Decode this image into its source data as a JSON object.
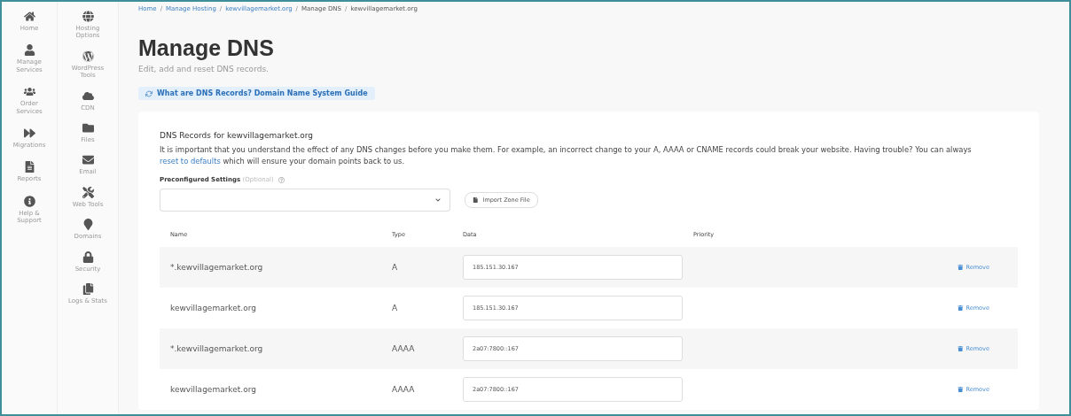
{
  "primary_nav": [
    {
      "label": "Home"
    },
    {
      "label": "Manage Services"
    },
    {
      "label": "Order Services"
    },
    {
      "label": "Migrations"
    },
    {
      "label": "Reports"
    },
    {
      "label": "Help & Support"
    }
  ],
  "secondary_nav": [
    {
      "label": "Hosting Options"
    },
    {
      "label": "WordPress Tools"
    },
    {
      "label": "CDN"
    },
    {
      "label": "Files"
    },
    {
      "label": "Email"
    },
    {
      "label": "Web Tools"
    },
    {
      "label": "Domains"
    },
    {
      "label": "Security"
    },
    {
      "label": "Logs & Stats"
    }
  ],
  "breadcrumb": {
    "separator": "/",
    "items": [
      {
        "label": "Home",
        "link": true
      },
      {
        "label": "Manage Hosting",
        "link": true
      },
      {
        "label": "kewvillagemarket.org",
        "link": true
      },
      {
        "label": "Manage DNS",
        "link": false
      },
      {
        "label": "kewvillagemarket.org",
        "link": false
      }
    ]
  },
  "title": "Manage DNS",
  "subtitle": "Edit, add and reset DNS records.",
  "guide_link": "What are DNS Records? Domain Name System Guide",
  "card": {
    "heading": "DNS Records for kewvillagemarket.org",
    "notice_before": "It is important that you understand the effect of any DNS changes before you make them. For example, an incorrect change to your A, AAAA or CNAME records could break your website.  Having trouble? You can always ",
    "notice_link": "reset to defaults",
    "notice_after": " which will ensure your domain points back to us.",
    "preconfigured_label": "Preconfigured Settings",
    "preconfigured_hint": "(Optional)",
    "import_button": "Import Zone File",
    "table": {
      "columns": [
        "Name",
        "Type",
        "Data",
        "Priority"
      ],
      "rows": [
        {
          "name": "*.kewvillagemarket.org",
          "type": "A",
          "data": "185.151.30.167",
          "action": "Remove"
        },
        {
          "name": "kewvillagemarket.org",
          "type": "A",
          "data": "185.151.30.167",
          "action": "Remove"
        },
        {
          "name": "*.kewvillagemarket.org",
          "type": "AAAA",
          "data": "2a07:7800::167",
          "action": "Remove"
        },
        {
          "name": "kewvillagemarket.org",
          "type": "AAAA",
          "data": "2a07:7800::167",
          "action": "Remove"
        }
      ]
    }
  }
}
